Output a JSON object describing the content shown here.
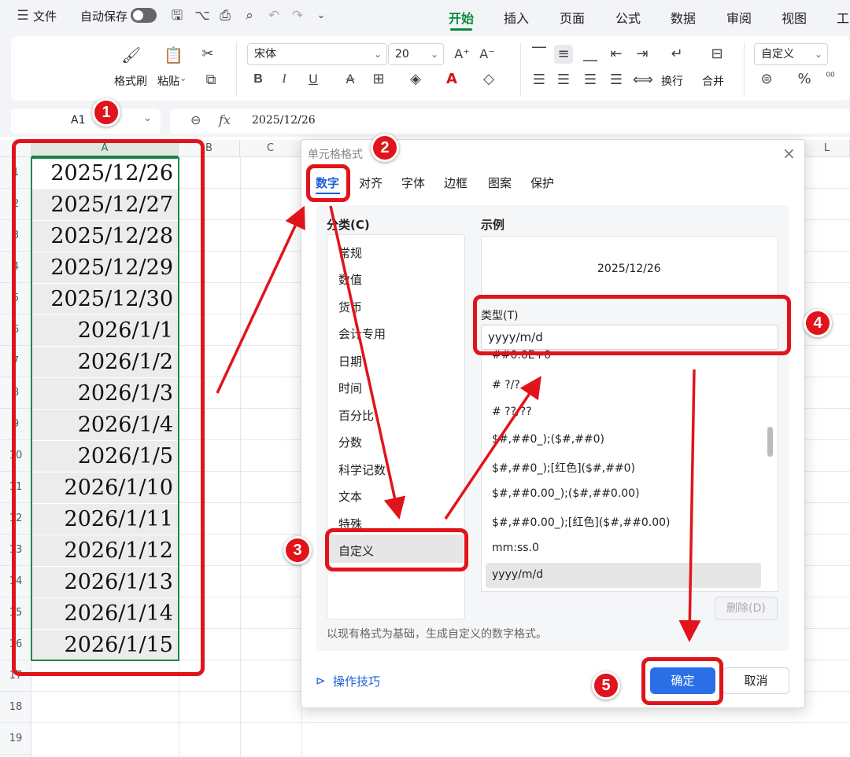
{
  "menubar": {
    "menu_icon": "hamburger-icon",
    "file_label": "文件",
    "autosave_label": "自动保存",
    "tabs": [
      "开始",
      "插入",
      "页面",
      "公式",
      "数据",
      "审阅",
      "视图",
      "工"
    ]
  },
  "ribbon": {
    "format_painter": "格式刷",
    "paste": "粘贴",
    "font_name": "宋体",
    "font_size": "20",
    "wrap_text": "换行",
    "merge": "合并",
    "number_format": "自定义"
  },
  "formula_bar": {
    "name_box": "A1",
    "fx_label": "fx",
    "formula": "2025/12/26"
  },
  "grid": {
    "columns": [
      "A",
      "B",
      "C",
      "L"
    ],
    "rows": [
      "1",
      "2",
      "3",
      "4",
      "5",
      "6",
      "7",
      "8",
      "9",
      "10",
      "11",
      "12",
      "13",
      "14",
      "15",
      "16",
      "17",
      "18",
      "19"
    ],
    "cells": [
      "2025/12/26",
      "2025/12/27",
      "2025/12/28",
      "2025/12/29",
      "2025/12/30",
      "2026/1/1",
      "2026/1/2",
      "2026/1/3",
      "2026/1/4",
      "2026/1/5",
      "2026/1/10",
      "2026/1/11",
      "2026/1/12",
      "2026/1/13",
      "2026/1/14",
      "2026/1/15"
    ]
  },
  "dialog": {
    "title": "单元格格式",
    "tabs": [
      "数字",
      "对齐",
      "字体",
      "边框",
      "图案",
      "保护"
    ],
    "category_label": "分类(C)",
    "categories": [
      "常规",
      "数值",
      "货币",
      "会计专用",
      "日期",
      "时间",
      "百分比",
      "分数",
      "科学记数",
      "文本",
      "特殊",
      "自定义"
    ],
    "selected_category": "自定义",
    "sample_label": "示例",
    "sample_value": "2025/12/26",
    "type_label": "类型(T)",
    "type_value": "yyyy/m/d",
    "format_list": [
      "##0.0E+0",
      "# ?/?",
      "# ??/??",
      "$#,##0_);($#,##0)",
      "$#,##0_);[红色]($#,##0)",
      "$#,##0.00_);($#,##0.00)",
      "$#,##0.00_);[红色]($#,##0.00)",
      "mm:ss.0",
      "yyyy/m/d"
    ],
    "delete_button": "删除(D)",
    "description": "以现有格式为基础，生成自定义的数字格式。",
    "tips_link": "操作技巧",
    "ok_button": "确定",
    "cancel_button": "取消"
  },
  "annotations": {
    "badges": [
      "1",
      "2",
      "3",
      "4",
      "5"
    ],
    "color": "#e1141b"
  },
  "colors": {
    "accent_green": "#0a8a3c",
    "ok_blue": "#2b6fe6"
  }
}
